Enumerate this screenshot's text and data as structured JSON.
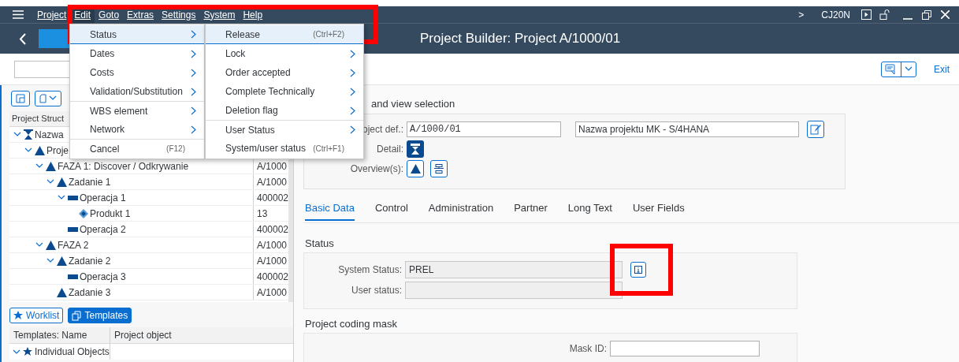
{
  "menubar": [
    {
      "label": "Project",
      "selected": false
    },
    {
      "label": "Edit",
      "selected": true
    },
    {
      "label": "Goto",
      "selected": false
    },
    {
      "label": "Extras",
      "selected": false
    },
    {
      "label": "Settings",
      "selected": false
    },
    {
      "label": "System",
      "selected": false
    },
    {
      "label": "Help",
      "selected": false
    }
  ],
  "system": {
    "arrow": ">",
    "transaction": "CJ20N"
  },
  "title": "Project Builder: Project A/1000/01",
  "toolbar": {
    "exit": "Exit"
  },
  "edit_menu": [
    {
      "label": "Status",
      "submenu": true,
      "selected": true,
      "separator_before": false
    },
    {
      "label": "Dates",
      "submenu": true,
      "selected": false,
      "separator_before": false
    },
    {
      "label": "Costs",
      "submenu": true,
      "selected": false,
      "separator_before": false
    },
    {
      "label": "Validation/Substitution",
      "submenu": true,
      "selected": false,
      "separator_before": false
    },
    {
      "label": "WBS element",
      "submenu": true,
      "selected": false,
      "separator_before": true
    },
    {
      "label": "Network",
      "submenu": true,
      "selected": false,
      "separator_before": false
    },
    {
      "label": "Cancel",
      "shortcut": "(F12)",
      "submenu": false,
      "selected": false,
      "separator_before": true
    }
  ],
  "status_menu": [
    {
      "label": "Release",
      "shortcut": "(Ctrl+F2)",
      "submenu": false,
      "selected": true,
      "separator_before": false
    },
    {
      "label": "Lock",
      "submenu": true,
      "selected": false,
      "separator_before": false
    },
    {
      "label": "Order accepted",
      "submenu": true,
      "selected": false,
      "separator_before": false
    },
    {
      "label": "Complete Technically",
      "submenu": true,
      "selected": false,
      "separator_before": false
    },
    {
      "label": "Deletion flag",
      "submenu": true,
      "selected": false,
      "separator_before": false
    },
    {
      "label": "User Status",
      "submenu": true,
      "selected": false,
      "separator_before": true
    },
    {
      "label": "System/user status",
      "shortcut": "(Ctrl+F1)",
      "submenu": false,
      "selected": false,
      "separator_before": false
    }
  ],
  "tree": {
    "header": "Project Struct",
    "rows": [
      {
        "label": "Nazwa",
        "kind": "project",
        "expanded": true,
        "children": [
          {
            "label": "Proje",
            "kind": "wbs",
            "expanded": true,
            "children": [
              {
                "label": "FAZA 1: Discover / Odkrywanie",
                "value": "A/1000",
                "kind": "wbs",
                "expanded": true,
                "children": [
                  {
                    "label": "Zadanie 1",
                    "value": "A/1000",
                    "kind": "wbs",
                    "expanded": true,
                    "children": [
                      {
                        "label": "Operacja 1",
                        "value": "400002",
                        "kind": "activity",
                        "expanded": true,
                        "children": [
                          {
                            "label": "Produkt 1",
                            "value": "13",
                            "kind": "material"
                          }
                        ]
                      },
                      {
                        "label": "Operacja 2",
                        "value": "400002",
                        "kind": "activity"
                      }
                    ]
                  }
                ]
              },
              {
                "label": "FAZA 2",
                "value": "A/1000",
                "kind": "wbs",
                "expanded": true,
                "children": [
                  {
                    "label": "Zadanie 2",
                    "value": "A/1000",
                    "kind": "wbs",
                    "expanded": true,
                    "children": [
                      {
                        "label": "Operacja 3",
                        "value": "400002",
                        "kind": "activity"
                      }
                    ]
                  },
                  {
                    "label": "Zadanie 3",
                    "value": "A/1000",
                    "kind": "wbs"
                  }
                ]
              }
            ]
          }
        ]
      }
    ]
  },
  "panel_buttons": [
    {
      "label": "Worklist",
      "selected": false
    },
    {
      "label": "Templates",
      "selected": true
    }
  ],
  "templates": {
    "columns": [
      "Templates: Name",
      "Project object"
    ],
    "rows": [
      {
        "name": "Individual Objects",
        "expanded": true
      }
    ]
  },
  "selection": {
    "title": "and view selection",
    "project_def_label": "oject def.:",
    "project_def": "A/1000/01",
    "description": "Nazwa projektu MK - S/4HANA",
    "detail_label": "Detail:",
    "overview_label": "Overview(s):"
  },
  "tabs": [
    {
      "label": "Basic Data",
      "selected": true
    },
    {
      "label": "Control",
      "selected": false
    },
    {
      "label": "Administration",
      "selected": false
    },
    {
      "label": "Partner",
      "selected": false
    },
    {
      "label": "Long Text",
      "selected": false
    },
    {
      "label": "User Fields",
      "selected": false
    }
  ],
  "status": {
    "title": "Status",
    "system_status_label": "System Status:",
    "system_status": "PREL",
    "user_status_label": "User status:"
  },
  "coding": {
    "title": "Project coding mask",
    "mask_label": "Mask ID:"
  }
}
